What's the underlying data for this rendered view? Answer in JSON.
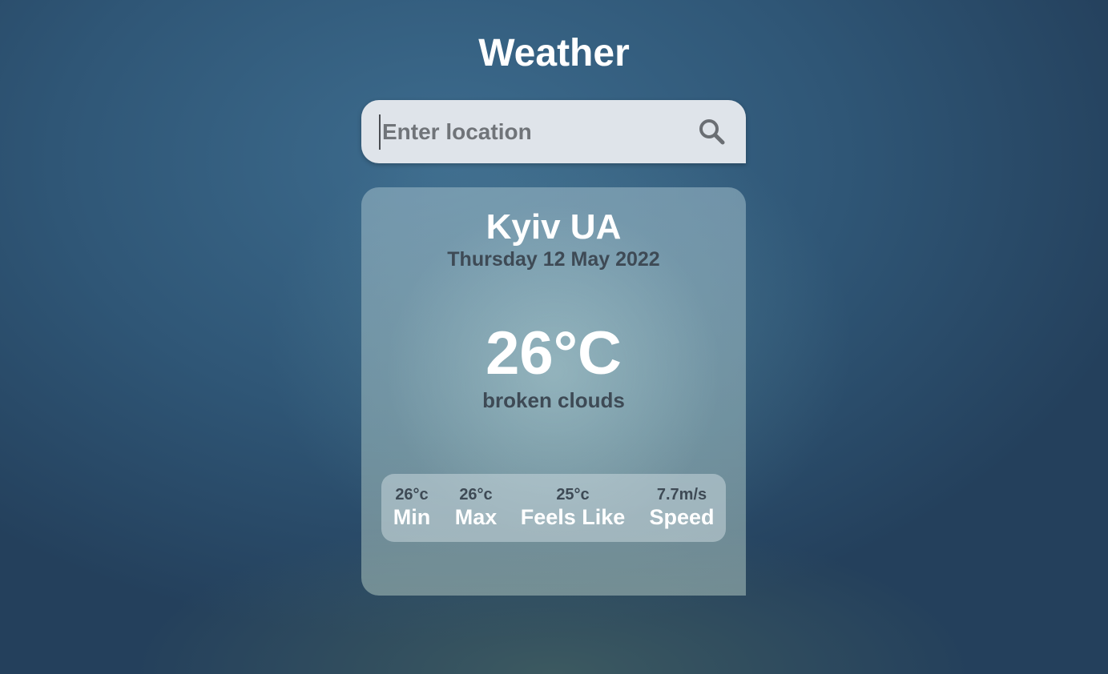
{
  "app": {
    "title": "Weather"
  },
  "search": {
    "placeholder": "Enter location",
    "value": "",
    "icon": "search-icon"
  },
  "weather": {
    "city": "Kyiv UA",
    "date": "Thursday 12 May 2022",
    "temperature": "26°C",
    "description": "broken clouds",
    "stats": [
      {
        "value": "26°c",
        "label": "Min"
      },
      {
        "value": "26°c",
        "label": "Max"
      },
      {
        "value": "25°c",
        "label": "Feels Like"
      },
      {
        "value": "7.7m/s",
        "label": "Speed"
      }
    ]
  },
  "colors": {
    "background": "#2f5676",
    "primary_text": "#ffffff",
    "secondary_text": "#3e4a55",
    "search_background": "#dfe4ea"
  }
}
